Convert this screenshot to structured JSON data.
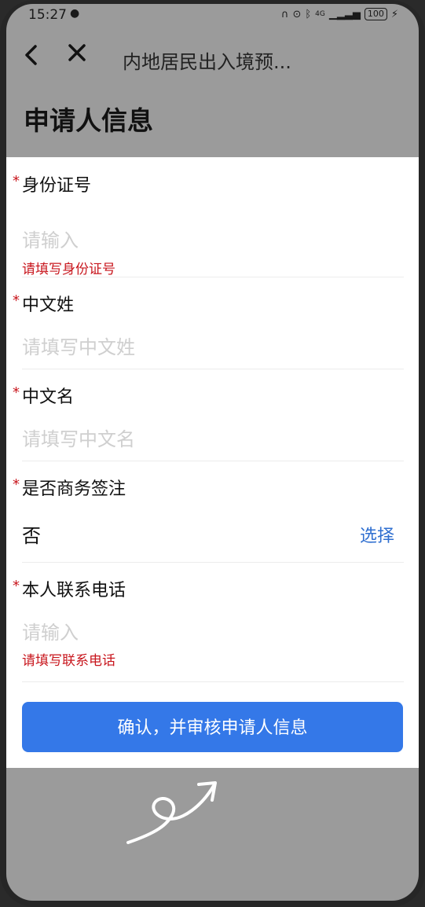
{
  "status_bar": {
    "time": "15:27",
    "network": "4G",
    "battery": "100"
  },
  "nav": {
    "title": "内地居民出入境预..."
  },
  "page_title": "申请人信息",
  "form": {
    "required_mark": "*",
    "id_number": {
      "label": "身份证号",
      "placeholder": "请输入",
      "error": "请填写身份证号"
    },
    "surname": {
      "label": "中文姓",
      "placeholder": "请填写中文姓"
    },
    "given_name": {
      "label": "中文名",
      "placeholder": "请填写中文名"
    },
    "business_endorsement": {
      "label": "是否商务签注",
      "value": "否",
      "action": "选择"
    },
    "phone": {
      "label": "本人联系电话",
      "placeholder": "请输入",
      "error": "请填写联系电话"
    }
  },
  "confirm_button": "确认，并审核申请人信息",
  "colors": {
    "primary": "#3478e8",
    "error": "#c8161d",
    "link": "#2f6fd0",
    "overlay": "#9b9b9b"
  },
  "icons": [
    "wechat-icon",
    "headphone-icon",
    "alarm-icon",
    "bluetooth-icon",
    "signal-icon",
    "battery-icon",
    "charging-icon",
    "back-icon",
    "close-icon",
    "gesture-icon"
  ]
}
